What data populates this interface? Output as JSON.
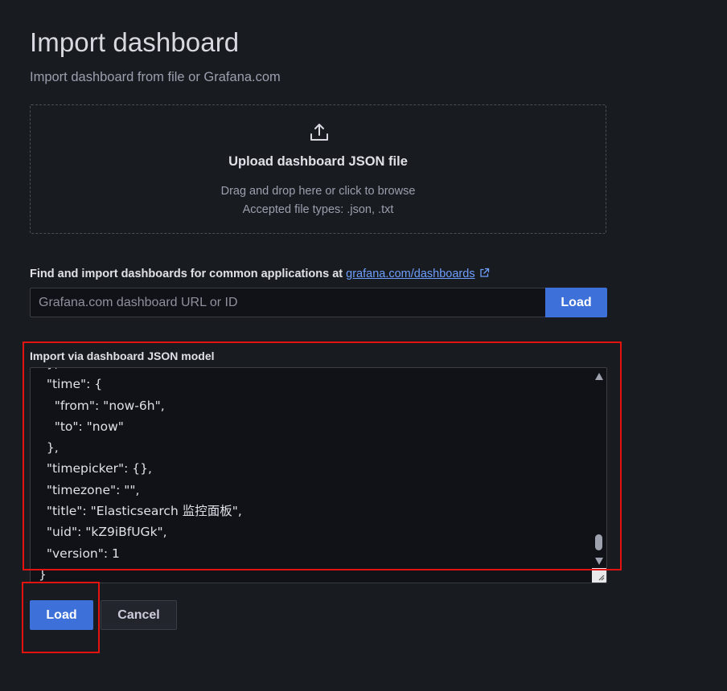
{
  "header": {
    "title": "Import dashboard",
    "subtitle": "Import dashboard from file or Grafana.com"
  },
  "upload": {
    "icon": "upload-icon",
    "title": "Upload dashboard JSON file",
    "hint": "Drag and drop here or click to browse",
    "accepted_types": "Accepted file types: .json, .txt"
  },
  "grafana_com": {
    "label": "Find and import dashboards for common applications at",
    "link_text": "grafana.com/dashboards",
    "link_icon": "external-link-icon",
    "input_placeholder": "Grafana.com dashboard URL or ID",
    "input_value": "",
    "load_label": "Load"
  },
  "json_model": {
    "label": "Import via dashboard JSON model",
    "lines": [
      "  },",
      "  \"time\": {",
      "    \"from\": \"now-6h\",",
      "    \"to\": \"now\"",
      "  },",
      "  \"timepicker\": {},",
      "  \"timezone\": \"\",",
      "  \"title\": \"Elasticsearch 监控面板\",",
      "  \"uid\": \"kZ9iBfUGk\",",
      "  \"version\": 1",
      "}"
    ]
  },
  "actions": {
    "load_label": "Load",
    "cancel_label": "Cancel"
  },
  "colors": {
    "background": "#181b1f",
    "primary": "#3d71d9",
    "link": "#6e9fff",
    "annotation": "#e3140f"
  }
}
